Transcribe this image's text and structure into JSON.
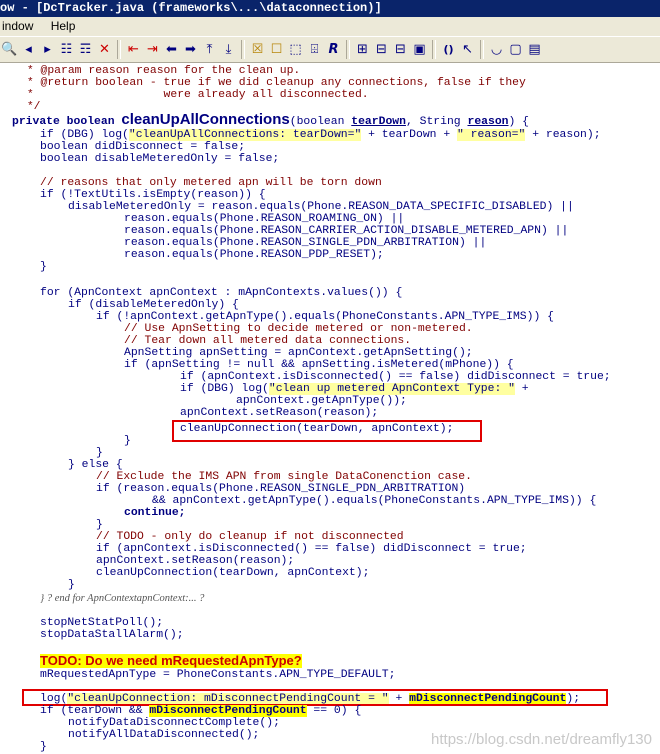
{
  "window": {
    "title": "ow - [DcTracker.java (frameworks\\...\\dataconnection)]"
  },
  "menu": {
    "window": "indow",
    "help": "Help"
  },
  "toolbar": {
    "icons": [
      "binoculars-icon",
      "binoculars-prev-icon",
      "binoculars-next-icon",
      "binoculars-all-icon",
      "binoculars-alt-icon",
      "find-close-icon",
      "bookmark-left-icon",
      "bookmark-right-icon",
      "arrow-left-icon",
      "arrow-right-icon",
      "jump-up-icon",
      "jump-out-icon",
      "lock-icon",
      "symbol-window-icon",
      "relation-icon",
      "book-icon",
      "regex-r-icon",
      "layout-1-icon",
      "layout-2-icon",
      "layout-3-icon",
      "layout-4-icon",
      "query-icon",
      "pointer-help-icon",
      "brace-icon",
      "screen-icon",
      "extra-icon"
    ]
  },
  "code": {
    "l1": " * @param reason reason for the clean up.",
    "l2": " * @return boolean - true if we did cleanup any connections, false if they",
    "l3": " *                   were already all disconnected.",
    "l4": " */",
    "l5_a": "private boolean ",
    "l5_fn": "cleanUpAllConnections",
    "l5_b": "(boolean ",
    "l5_p1": "tearDown",
    "l5_c": ", String ",
    "l5_p2": "reason",
    "l5_d": ") {",
    "l6_a": "if (DBG) log(",
    "l6_b": "\"cleanUpAllConnections: tearDown=\"",
    "l6_c": " + tearDown + ",
    "l6_d": "\" reason=\"",
    "l6_e": " + reason);",
    "l7": "boolean didDisconnect = false;",
    "l8": "boolean disableMeteredOnly = false;",
    "l9": "// reasons that only metered apn will be torn down",
    "l10": "if (!TextUtils.isEmpty(reason)) {",
    "l11": "disableMeteredOnly = reason.equals(Phone.REASON_DATA_SPECIFIC_DISABLED) ||",
    "l12": "reason.equals(Phone.REASON_ROAMING_ON) ||",
    "l13": "reason.equals(Phone.REASON_CARRIER_ACTION_DISABLE_METERED_APN) ||",
    "l14": "reason.equals(Phone.REASON_SINGLE_PDN_ARBITRATION) ||",
    "l15": "reason.equals(Phone.REASON_PDP_RESET);",
    "l16": "}",
    "l17": "for (ApnContext apnContext : mApnContexts.values()) {",
    "l18": "if (disableMeteredOnly) {",
    "l19": "if (!apnContext.getApnType().equals(PhoneConstants.APN_TYPE_IMS)) {",
    "l20": "// Use ApnSetting to decide metered or non-metered.",
    "l21": "// Tear down all metered data connections.",
    "l22": "ApnSetting apnSetting = apnContext.getApnSetting();",
    "l23": "if (apnSetting != null && apnSetting.isMetered(mPhone)) {",
    "l24": "if (apnContext.isDisconnected() == false) didDisconnect = true;",
    "l25_a": "if (DBG) log(",
    "l25_b": "\"clean up metered ApnContext Type: \"",
    "l25_c": " +",
    "l26": "apnContext.getApnType());",
    "l27": "apnContext.setReason(reason);",
    "l28": "cleanUpConnection(tearDown, apnContext);",
    "l29": "}",
    "l30": "}",
    "l31": "} else {",
    "l32": "// Exclude the IMS APN from single DataConenction case.",
    "l33": "if (reason.equals(Phone.REASON_SINGLE_PDN_ARBITRATION)",
    "l34": "&& apnContext.getApnType().equals(PhoneConstants.APN_TYPE_IMS)) {",
    "l35": "continue;",
    "l36": "}",
    "l37": "// TODO - only do cleanup if not disconnected",
    "l38": "if (apnContext.isDisconnected() == false) didDisconnect = true;",
    "l39": "apnContext.setReason(reason);",
    "l40": "cleanUpConnection(tearDown, apnContext);",
    "l41": "}",
    "l42": "} ? end for ApnContextapnContext:... ?",
    "l43": "stopNetStatPoll();",
    "l44": "stopDataStallAlarm();",
    "l45": "TODO: Do we need mRequestedApnType?",
    "l46": "mRequestedApnType = PhoneConstants.APN_TYPE_DEFAULT;",
    "l47_a": "log(",
    "l47_b": "\"cleanUpConnection: mDisconnectPendingCount = \"",
    "l47_c": " + ",
    "l47_d": "mDisconnectPendingCount",
    "l47_e": ");",
    "l48_a": "if (tearDown && ",
    "l48_b": "mDisconnectPendingCount",
    "l48_c": " == 0) {",
    "l49": "notifyDataDisconnectComplete();",
    "l50": "notifyAllDataDisconnected();",
    "l51": "}"
  },
  "watermark": "https://blog.csdn.net/dreamfly130"
}
